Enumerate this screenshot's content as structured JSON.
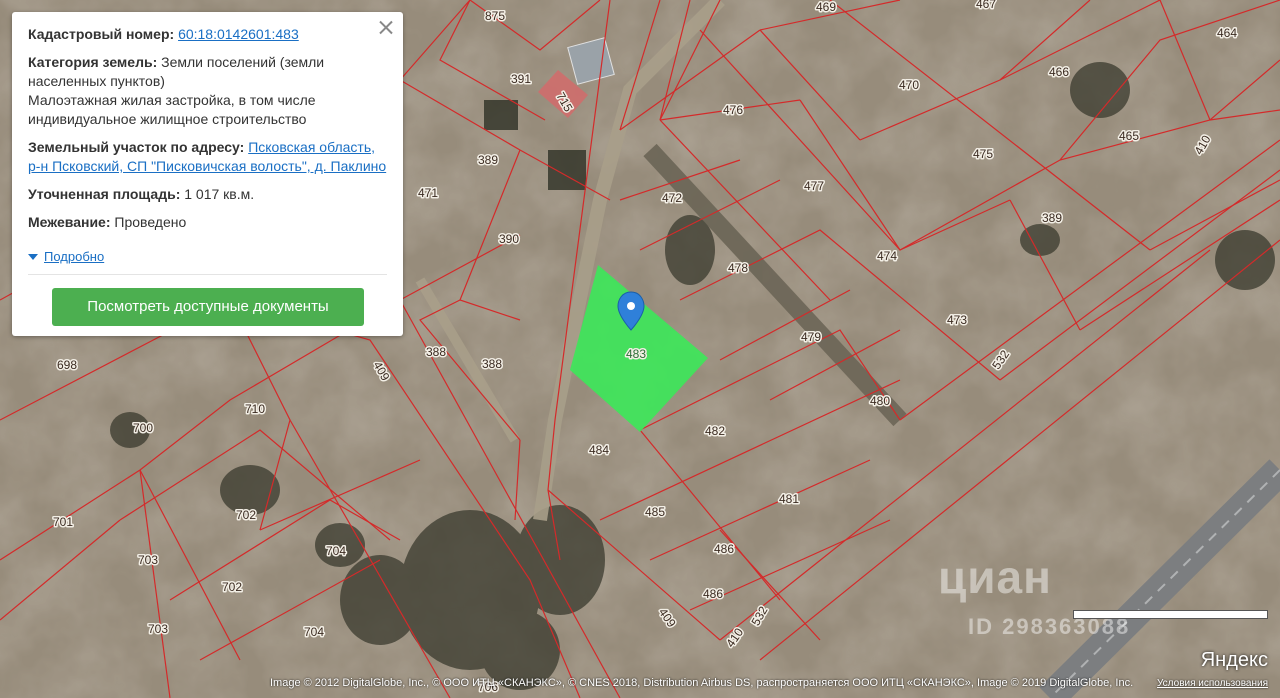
{
  "info": {
    "cadastral_label": "Кадастровый номер:",
    "cadastral_value": "60:18:0142601:483",
    "category_label": "Категория земель:",
    "category_value": "Земли поселений (земли населенных пунктов)",
    "usage": "Малоэтажная жилая застройка, в том числе индивидуальное жилищное строительство",
    "address_label": "Земельный участок по адресу:",
    "address_value": "Псковская область, р-н Псковский, СП \"Писковичская волость\", д. Паклино",
    "area_label": "Уточненная площадь:",
    "area_value": "1 017 кв.м.",
    "survey_label": "Межевание:",
    "survey_value": "Проведено",
    "more_link": "Подробно",
    "docs_button": "Посмотреть доступные документы"
  },
  "map": {
    "selected_plot": "483",
    "plots": [
      "875",
      "469",
      "467",
      "464",
      "391",
      "715",
      "466",
      "470",
      "476",
      "465",
      "410",
      "389",
      "471",
      "475",
      "477",
      "472",
      "389",
      "390",
      "474",
      "478",
      "473",
      "532",
      "479",
      "388",
      "388",
      "698",
      "409",
      "480",
      "710",
      "482",
      "700",
      "484",
      "481",
      "701",
      "702",
      "485",
      "486",
      "703",
      "704",
      "702",
      "486",
      "703",
      "704",
      "409",
      "410",
      "532",
      "706"
    ],
    "colors": {
      "boundary": "#d42a2a",
      "selected_fill": "#3ee65a",
      "marker": "#2f80d9",
      "button": "#4caf50",
      "link": "#1a6fc4"
    }
  },
  "attribution": "Image © 2012 DigitalGlobe, Inc., © ООО ИТЦ «СКАНЭКС», © CNES 2018, Distribution Airbus DS, распространяется ООО ИТЦ «СКАНЭКС», Image © 2019 DigitalGlobe, Inc.",
  "terms": "Условия использования",
  "provider": "Яндекс",
  "watermark": "циан",
  "watermark_id": "ID 298363088"
}
